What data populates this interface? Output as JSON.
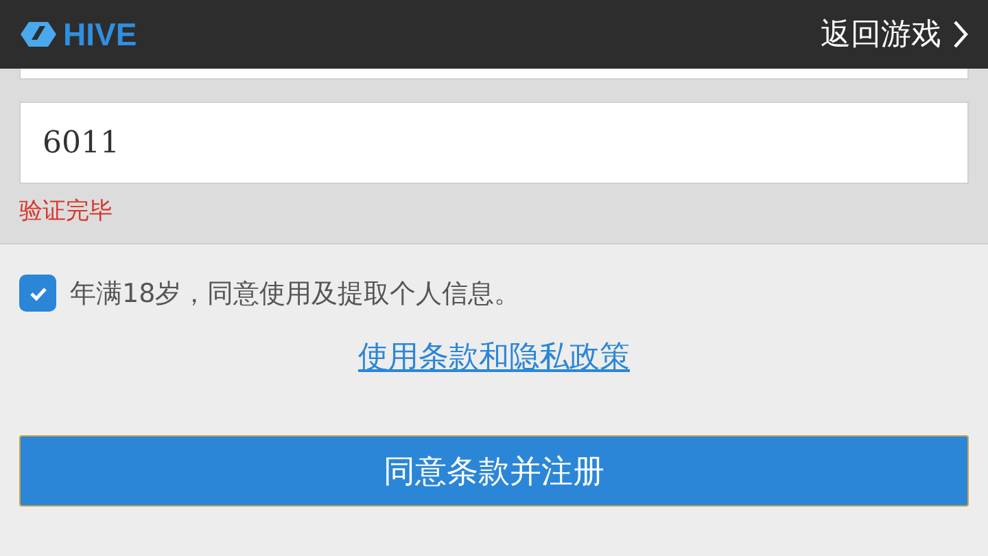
{
  "header": {
    "logo_text": "HIVE",
    "back_link": "返回游戏"
  },
  "code_field": {
    "value": "6011"
  },
  "verification_message": "验证完毕",
  "consent": {
    "label": "年满18岁，同意使用及提取个人信息。",
    "checked": true
  },
  "terms_link": "使用条款和隐私政策",
  "submit_button": "同意条款并注册"
}
